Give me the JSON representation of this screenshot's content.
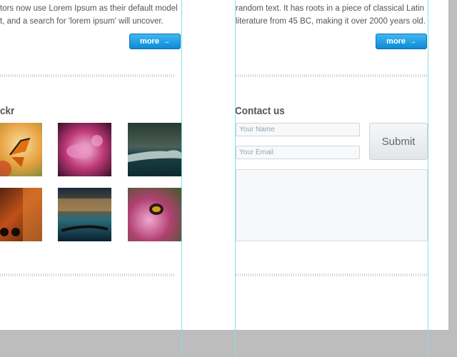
{
  "column_left": {
    "text_lines": [
      "tors now use Lorem Ipsum as their default model",
      "t, and a search for 'lorem ipsum' will uncover."
    ],
    "more_label": "more"
  },
  "column_right": {
    "text_lines": [
      "random text. It has roots in a piece of classical Latin",
      "literature from 45 BC, making it over 2000 years old."
    ],
    "more_label": "more"
  },
  "flickr": {
    "heading": "ckr",
    "thumbnails": [
      "butterfly",
      "pink-flower",
      "ocean-wave",
      "street-scooter",
      "gondola-night",
      "bee-flower"
    ]
  },
  "contact": {
    "heading": "Contact us",
    "name_placeholder": "Your Name",
    "email_placeholder": "Your Email",
    "submit_label": "Submit"
  }
}
